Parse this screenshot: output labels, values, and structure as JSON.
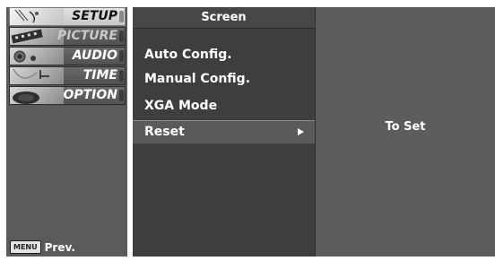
{
  "menu": {
    "items": [
      {
        "label": "SETUP",
        "icon": "satellite-dish-icon"
      },
      {
        "label": "PICTURE",
        "icon": "film-strip-icon"
      },
      {
        "label": "AUDIO",
        "icon": "speaker-icon"
      },
      {
        "label": "TIME",
        "icon": "clock-icon"
      },
      {
        "label": "OPTION",
        "icon": "option-disc-icon"
      }
    ],
    "selected": "SETUP",
    "prev_key": "MENU",
    "prev_label": "Prev."
  },
  "submenu": {
    "title": "Screen",
    "items": [
      "Auto Config.",
      "Manual Config.",
      "XGA Mode",
      "Reset"
    ],
    "active": "Reset"
  },
  "info": {
    "text": "To Set"
  },
  "colors": {
    "left_panel": "#5b5b5b",
    "center_panel": "#3e3e3e",
    "right_panel": "#5d5d5d",
    "active_row": "#5a5a5a",
    "text": "#ffffff"
  }
}
